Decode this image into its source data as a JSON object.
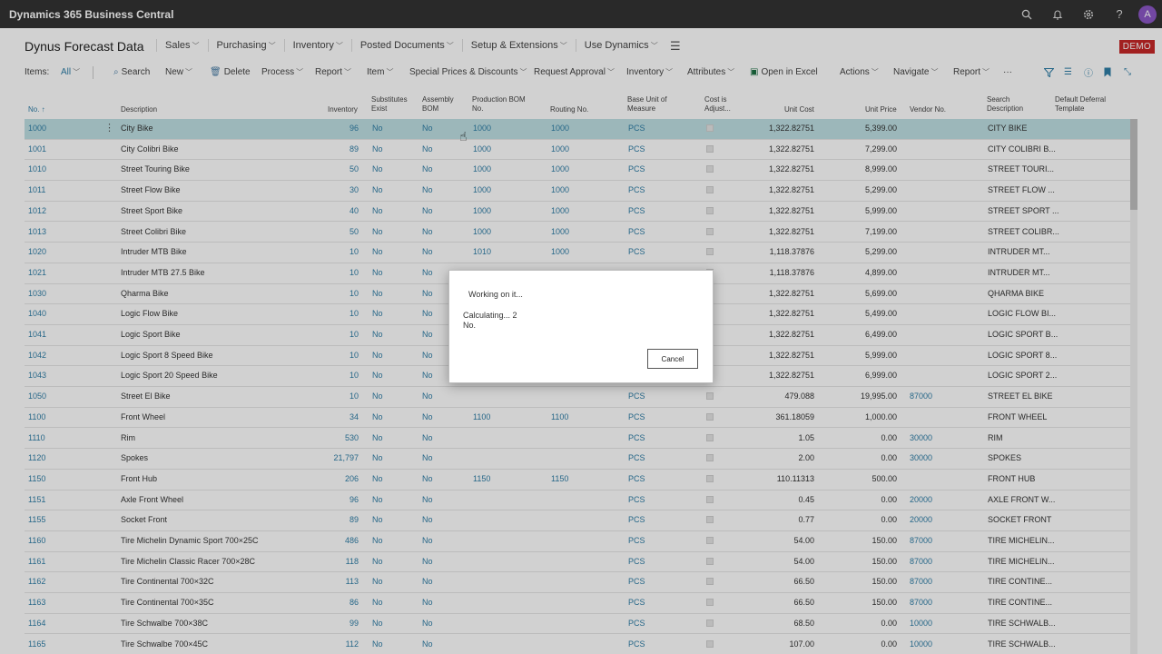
{
  "app": {
    "title": "Dynamics 365 Business Central",
    "avatar_initial": "A"
  },
  "topbar_icons": [
    "search-icon",
    "bell-icon",
    "gear-icon",
    "help-icon"
  ],
  "page": {
    "title": "Dynus Forecast Data",
    "nav": [
      "Sales",
      "Purchasing",
      "Inventory",
      "Posted Documents",
      "Setup & Extensions",
      "Use Dynamics"
    ],
    "badge": "DEMO"
  },
  "actionbar": {
    "items_label": "Items:",
    "filter_value": "All",
    "search": "Search",
    "new": "New",
    "delete": "Delete",
    "process": "Process",
    "report": "Report",
    "item": "Item",
    "special_prices": "Special Prices & Discounts",
    "request_approval": "Request Approval",
    "inventory": "Inventory",
    "attributes": "Attributes",
    "open_in_excel": "Open in Excel",
    "actions": "Actions",
    "navigate": "Navigate",
    "report2": "Report",
    "more": "···"
  },
  "columns": {
    "no": "No. ↑",
    "description": "Description",
    "inventory": "Inventory",
    "substitutes_1": "Substitutes",
    "substitutes_2": "Exist",
    "assembly_1": "Assembly",
    "assembly_2": "BOM",
    "prodbom_1": "Production BOM",
    "prodbom_2": "No.",
    "routing": "Routing No.",
    "baseunit_1": "Base Unit of",
    "baseunit_2": "Measure",
    "costadj_1": "Cost is",
    "costadj_2": "Adjust...",
    "unit_cost": "Unit Cost",
    "unit_price": "Unit Price",
    "vendor": "Vendor No.",
    "search_1": "Search",
    "search_2": "Description",
    "deferral_1": "Default Deferral",
    "deferral_2": "Template"
  },
  "rows": [
    {
      "no": "1000",
      "desc": "City Bike",
      "inv": "96",
      "sub": "No",
      "asm": "No",
      "bom": "1000",
      "route": "1000",
      "uom": "PCS",
      "cost": "1,322.82751",
      "price": "5,399.00",
      "vendor": "",
      "search": "CITY BIKE"
    },
    {
      "no": "1001",
      "desc": "City Colibri Bike",
      "inv": "89",
      "sub": "No",
      "asm": "No",
      "bom": "1000",
      "route": "1000",
      "uom": "PCS",
      "cost": "1,322.82751",
      "price": "7,299.00",
      "vendor": "",
      "search": "CITY COLIBRI B..."
    },
    {
      "no": "1010",
      "desc": "Street Touring Bike",
      "inv": "50",
      "sub": "No",
      "asm": "No",
      "bom": "1000",
      "route": "1000",
      "uom": "PCS",
      "cost": "1,322.82751",
      "price": "8,999.00",
      "vendor": "",
      "search": "STREET TOURI..."
    },
    {
      "no": "1011",
      "desc": "Street Flow Bike",
      "inv": "30",
      "sub": "No",
      "asm": "No",
      "bom": "1000",
      "route": "1000",
      "uom": "PCS",
      "cost": "1,322.82751",
      "price": "5,299.00",
      "vendor": "",
      "search": "STREET FLOW ..."
    },
    {
      "no": "1012",
      "desc": "Street Sport Bike",
      "inv": "40",
      "sub": "No",
      "asm": "No",
      "bom": "1000",
      "route": "1000",
      "uom": "PCS",
      "cost": "1,322.82751",
      "price": "5,999.00",
      "vendor": "",
      "search": "STREET SPORT ..."
    },
    {
      "no": "1013",
      "desc": "Street Colibri Bike",
      "inv": "50",
      "sub": "No",
      "asm": "No",
      "bom": "1000",
      "route": "1000",
      "uom": "PCS",
      "cost": "1,322.82751",
      "price": "7,199.00",
      "vendor": "",
      "search": "STREET COLIBR..."
    },
    {
      "no": "1020",
      "desc": "Intruder MTB Bike",
      "inv": "10",
      "sub": "No",
      "asm": "No",
      "bom": "1010",
      "route": "1000",
      "uom": "PCS",
      "cost": "1,118.37876",
      "price": "5,299.00",
      "vendor": "",
      "search": "INTRUDER MT..."
    },
    {
      "no": "1021",
      "desc": "Intruder MTB 27.5 Bike",
      "inv": "10",
      "sub": "No",
      "asm": "No",
      "bom": "",
      "route": "",
      "uom": "",
      "cost": "1,118.37876",
      "price": "4,899.00",
      "vendor": "",
      "search": "INTRUDER MT..."
    },
    {
      "no": "1030",
      "desc": "Qharma Bike",
      "inv": "10",
      "sub": "No",
      "asm": "No",
      "bom": "",
      "route": "",
      "uom": "",
      "cost": "1,322.82751",
      "price": "5,699.00",
      "vendor": "",
      "search": "QHARMA BIKE"
    },
    {
      "no": "1040",
      "desc": "Logic Flow Bike",
      "inv": "10",
      "sub": "No",
      "asm": "No",
      "bom": "",
      "route": "",
      "uom": "",
      "cost": "1,322.82751",
      "price": "5,499.00",
      "vendor": "",
      "search": "LOGIC FLOW BI..."
    },
    {
      "no": "1041",
      "desc": "Logic Sport Bike",
      "inv": "10",
      "sub": "No",
      "asm": "No",
      "bom": "",
      "route": "",
      "uom": "",
      "cost": "1,322.82751",
      "price": "6,499.00",
      "vendor": "",
      "search": "LOGIC SPORT B..."
    },
    {
      "no": "1042",
      "desc": "Logic Sport 8 Speed Bike",
      "inv": "10",
      "sub": "No",
      "asm": "No",
      "bom": "",
      "route": "",
      "uom": "",
      "cost": "1,322.82751",
      "price": "5,999.00",
      "vendor": "",
      "search": "LOGIC SPORT 8..."
    },
    {
      "no": "1043",
      "desc": "Logic Sport 20 Speed Bike",
      "inv": "10",
      "sub": "No",
      "asm": "No",
      "bom": "",
      "route": "",
      "uom": "",
      "cost": "1,322.82751",
      "price": "6,999.00",
      "vendor": "",
      "search": "LOGIC SPORT 2..."
    },
    {
      "no": "1050",
      "desc": "Street El Bike",
      "inv": "10",
      "sub": "No",
      "asm": "No",
      "bom": "",
      "route": "",
      "uom": "PCS",
      "cost": "479.088",
      "price": "19,995.00",
      "vendor": "87000",
      "search": "STREET EL BIKE"
    },
    {
      "no": "1100",
      "desc": "Front Wheel",
      "inv": "34",
      "sub": "No",
      "asm": "No",
      "bom": "1100",
      "route": "1100",
      "uom": "PCS",
      "cost": "361.18059",
      "price": "1,000.00",
      "vendor": "",
      "search": "FRONT WHEEL"
    },
    {
      "no": "1110",
      "desc": "Rim",
      "inv": "530",
      "sub": "No",
      "asm": "No",
      "bom": "",
      "route": "",
      "uom": "PCS",
      "cost": "1.05",
      "price": "0.00",
      "vendor": "30000",
      "search": "RIM"
    },
    {
      "no": "1120",
      "desc": "Spokes",
      "inv": "21,797",
      "sub": "No",
      "asm": "No",
      "bom": "",
      "route": "",
      "uom": "PCS",
      "cost": "2.00",
      "price": "0.00",
      "vendor": "30000",
      "search": "SPOKES"
    },
    {
      "no": "1150",
      "desc": "Front Hub",
      "inv": "206",
      "sub": "No",
      "asm": "No",
      "bom": "1150",
      "route": "1150",
      "uom": "PCS",
      "cost": "110.11313",
      "price": "500.00",
      "vendor": "",
      "search": "FRONT HUB"
    },
    {
      "no": "1151",
      "desc": "Axle Front Wheel",
      "inv": "96",
      "sub": "No",
      "asm": "No",
      "bom": "",
      "route": "",
      "uom": "PCS",
      "cost": "0.45",
      "price": "0.00",
      "vendor": "20000",
      "search": "AXLE FRONT W..."
    },
    {
      "no": "1155",
      "desc": "Socket Front",
      "inv": "89",
      "sub": "No",
      "asm": "No",
      "bom": "",
      "route": "",
      "uom": "PCS",
      "cost": "0.77",
      "price": "0.00",
      "vendor": "20000",
      "search": "SOCKET FRONT"
    },
    {
      "no": "1160",
      "desc": "Tire Michelin Dynamic Sport 700×25C",
      "inv": "486",
      "sub": "No",
      "asm": "No",
      "bom": "",
      "route": "",
      "uom": "PCS",
      "cost": "54.00",
      "price": "150.00",
      "vendor": "87000",
      "search": "TIRE MICHELIN..."
    },
    {
      "no": "1161",
      "desc": "Tire Michelin Classic Racer 700×28C",
      "inv": "118",
      "sub": "No",
      "asm": "No",
      "bom": "",
      "route": "",
      "uom": "PCS",
      "cost": "54.00",
      "price": "150.00",
      "vendor": "87000",
      "search": "TIRE MICHELIN..."
    },
    {
      "no": "1162",
      "desc": "Tire Continental 700×32C",
      "inv": "113",
      "sub": "No",
      "asm": "No",
      "bom": "",
      "route": "",
      "uom": "PCS",
      "cost": "66.50",
      "price": "150.00",
      "vendor": "87000",
      "search": "TIRE CONTINE..."
    },
    {
      "no": "1163",
      "desc": "Tire Continental 700×35C",
      "inv": "86",
      "sub": "No",
      "asm": "No",
      "bom": "",
      "route": "",
      "uom": "PCS",
      "cost": "66.50",
      "price": "150.00",
      "vendor": "87000",
      "search": "TIRE CONTINE..."
    },
    {
      "no": "1164",
      "desc": "Tire Schwalbe 700×38C",
      "inv": "99",
      "sub": "No",
      "asm": "No",
      "bom": "",
      "route": "",
      "uom": "PCS",
      "cost": "68.50",
      "price": "0.00",
      "vendor": "10000",
      "search": "TIRE SCHWALB..."
    },
    {
      "no": "1165",
      "desc": "Tire Schwalbe 700×45C",
      "inv": "112",
      "sub": "No",
      "asm": "No",
      "bom": "",
      "route": "",
      "uom": "PCS",
      "cost": "107.00",
      "price": "0.00",
      "vendor": "10000",
      "search": "TIRE SCHWALB..."
    }
  ],
  "dialog": {
    "title": "Working on it...",
    "line1": "Calculating... 2",
    "line2": "No.",
    "cancel": "Cancel"
  },
  "colors": {
    "topbar": "#333333",
    "link": "#2f7ea7",
    "selected_row": "#bfe0e3",
    "badge": "#c62828",
    "avatar": "#8b57c6"
  }
}
